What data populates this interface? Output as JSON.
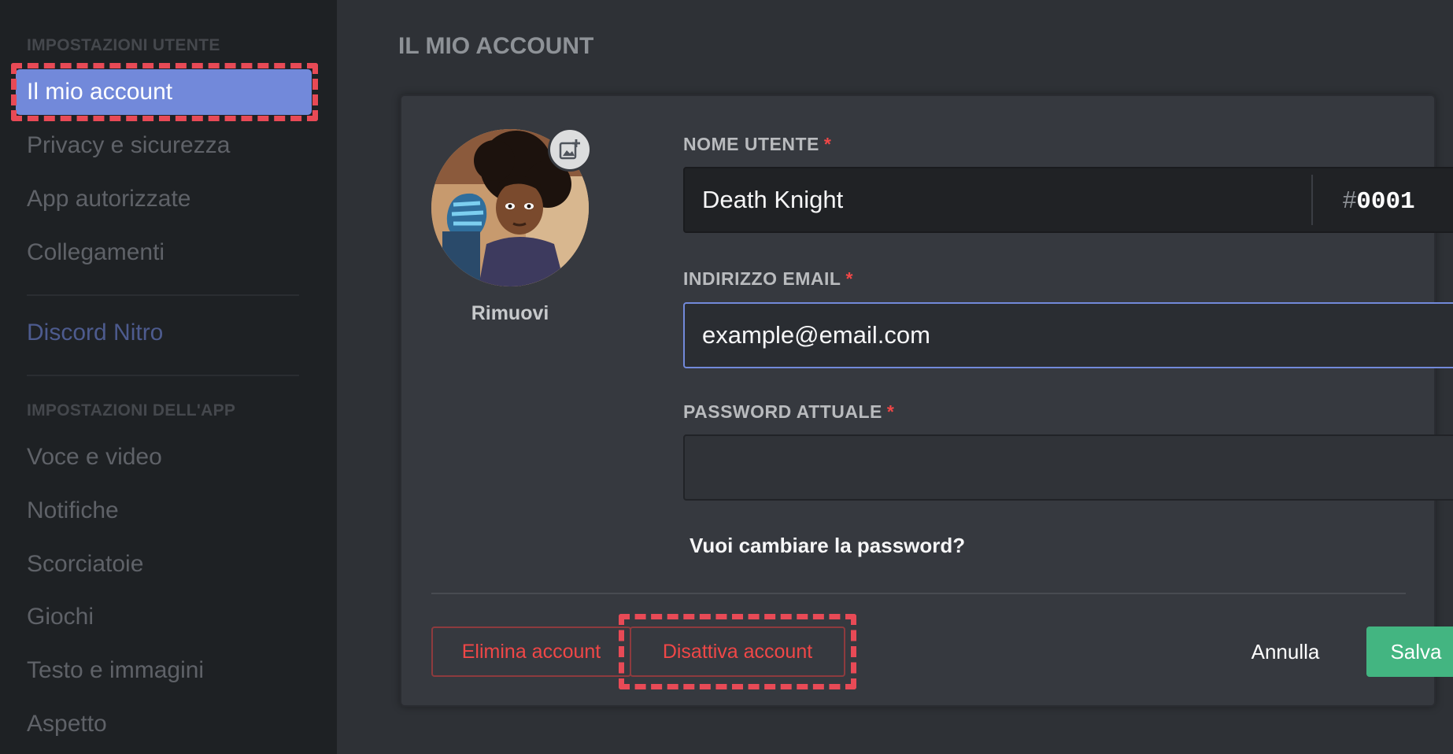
{
  "sidebar": {
    "user_settings_header": "IMPOSTAZIONI UTENTE",
    "user_items": [
      {
        "label": "Il mio account"
      },
      {
        "label": "Privacy e sicurezza"
      },
      {
        "label": "App autorizzate"
      },
      {
        "label": "Collegamenti"
      }
    ],
    "nitro_label": "Discord Nitro",
    "app_settings_header": "IMPOSTAZIONI DELL'APP",
    "app_items": [
      {
        "label": "Voce e video"
      },
      {
        "label": "Notifiche"
      },
      {
        "label": "Scorciatoie"
      },
      {
        "label": "Giochi"
      },
      {
        "label": "Testo e immagini"
      },
      {
        "label": "Aspetto"
      }
    ]
  },
  "main": {
    "title": "IL MIO ACCOUNT",
    "avatar": {
      "remove_label": "Rimuovi",
      "upload_icon": "image-add-icon"
    },
    "username": {
      "label": "NOME UTENTE",
      "required_mark": "*",
      "value": "Death Knight",
      "discriminator_hash": "#",
      "discriminator": "0001"
    },
    "email": {
      "label": "INDIRIZZO EMAIL",
      "required_mark": "*",
      "value": "example@email.com"
    },
    "password": {
      "label": "PASSWORD ATTUALE",
      "required_mark": "*",
      "value": ""
    },
    "change_password_link": "Vuoi cambiare la password?",
    "buttons": {
      "delete": "Elimina account",
      "disable": "Disattiva account",
      "cancel": "Annulla",
      "save": "Salva"
    }
  },
  "colors": {
    "accent": "#7289da",
    "danger": "#f04747",
    "success": "#43b581",
    "highlight": "#e84a56"
  }
}
